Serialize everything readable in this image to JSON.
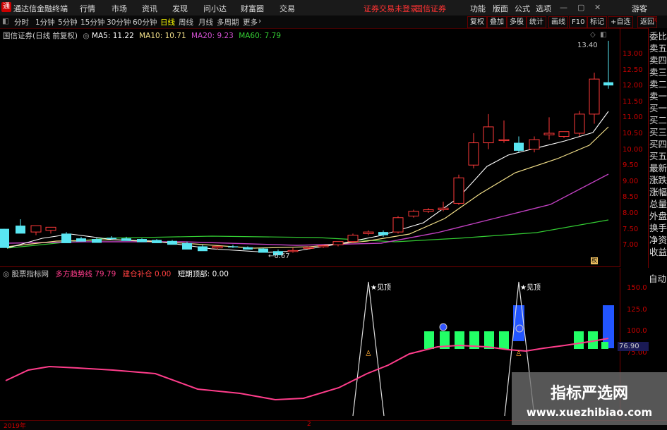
{
  "topbar": {
    "app_title": "通达信金融终端",
    "menu": [
      "行情",
      "市场",
      "资讯",
      "发现",
      "问小达",
      "财富圈",
      "交易"
    ],
    "login_status": "证券交易未登录",
    "broker": "国信证券",
    "right_menu": [
      "功能",
      "版面",
      "公式",
      "选项"
    ],
    "guest": "游客"
  },
  "toolbar": {
    "periods": [
      "分时",
      "1分钟",
      "5分钟",
      "15分钟",
      "30分钟",
      "60分钟",
      "日线",
      "周线",
      "月线",
      "多周期",
      "更多"
    ],
    "selected": "日线",
    "right_buttons": [
      "复权",
      "叠加",
      "多股",
      "统计",
      "画线",
      "F10",
      "标记",
      "+自选",
      "返回"
    ]
  },
  "main": {
    "stock_label": "国信证券(日线 前复权)",
    "ma5": "MA5: 11.22",
    "ma10": "MA10: 10.71",
    "ma20": "MA20: 9.23",
    "ma60": "MA60: 7.79",
    "high_label": "13.40",
    "low_label": "6.67",
    "y_ticks": [
      "13.00",
      "12.50",
      "12.00",
      "11.50",
      "11.00",
      "10.50",
      "10.00",
      "9.50",
      "9.00",
      "8.50",
      "8.00",
      "7.50",
      "7.00"
    ]
  },
  "indicator": {
    "name": "股票指标网",
    "trend_label": "多方趋势线",
    "trend_value": "79.79",
    "buy_label": "建仓补仓",
    "buy_value": "0.00",
    "top_label": "短期顶部:",
    "top_value": "0.00",
    "top_marker": "见顶",
    "y_ticks": [
      "150.0",
      "125.0",
      "100.0",
      "75.00"
    ],
    "current_value": "76.90"
  },
  "right_panel": [
    "委比",
    "卖五",
    "卖四",
    "卖三",
    "卖二",
    "卖一",
    "买一",
    "买二",
    "买三",
    "买四",
    "买五",
    "最新",
    "涨跌",
    "涨幅",
    "总量",
    "外盘",
    "换手",
    "净资",
    "收益"
  ],
  "auto_label": "自动",
  "bottom": {
    "year": "2019年",
    "marker": "2"
  },
  "watermark": {
    "cn": "指标严选网",
    "url": "www.xuezhibiao.com"
  },
  "colors": {
    "up": "#ff3a3a",
    "down": "#59e6f2",
    "ma5": "#ffffff",
    "ma10": "#f3e08a",
    "ma20": "#c040c0",
    "ma60": "#33cc33",
    "trend": "#ff3d8b",
    "green_bar": "#22ff66",
    "blue_bar": "#2255ff"
  }
}
